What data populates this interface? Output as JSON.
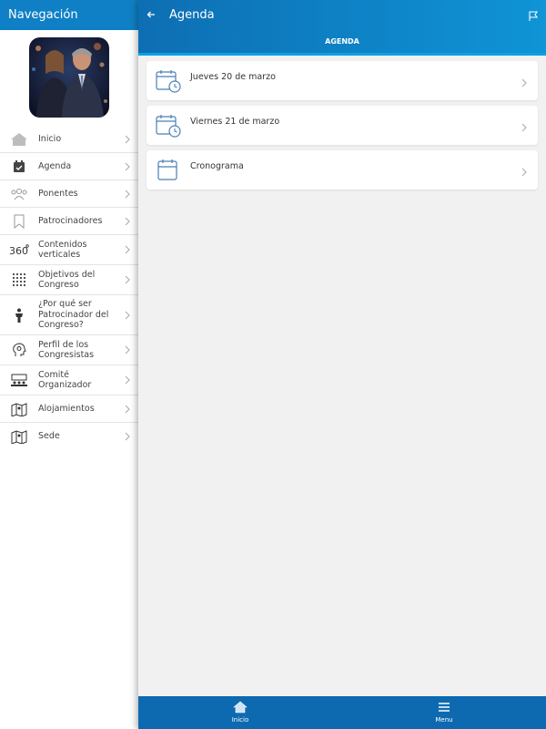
{
  "sidebar": {
    "header": "Navegación",
    "items": [
      {
        "label": "Inicio",
        "icon": "home-icon"
      },
      {
        "label": "Agenda",
        "icon": "calendar-check-icon"
      },
      {
        "label": "Ponentes",
        "icon": "people-icon"
      },
      {
        "label": "Patrocinadores",
        "icon": "bookmark-icon"
      },
      {
        "label": "Contenidos verticales",
        "icon": "360-icon"
      },
      {
        "label": "Objetivos del Congreso",
        "icon": "grid-icon"
      },
      {
        "label": "¿Por qué ser Patrocinador del Congreso?",
        "icon": "person-icon"
      },
      {
        "label": "Perfil de los Congresistas",
        "icon": "head-gear-icon"
      },
      {
        "label": "Comité Organizador",
        "icon": "committee-icon"
      },
      {
        "label": "Alojamientos",
        "icon": "map-icon"
      },
      {
        "label": "Sede",
        "icon": "map-icon"
      }
    ]
  },
  "topbar": {
    "title": "Agenda"
  },
  "tabs": {
    "active": "AGENDA"
  },
  "agenda": {
    "items": [
      {
        "label": "Jueves 20 de marzo",
        "icon": "calendar-clock-icon"
      },
      {
        "label": "Viernes 21 de marzo",
        "icon": "calendar-clock-icon"
      },
      {
        "label": "Cronograma",
        "icon": "calendar-icon"
      }
    ]
  },
  "bottombar": {
    "home_label": "Inicio",
    "menu_label": "Menu"
  },
  "colors": {
    "primary": "#0f80c5",
    "accent": "#0aa0e6",
    "icon": "#4a7fb5"
  }
}
